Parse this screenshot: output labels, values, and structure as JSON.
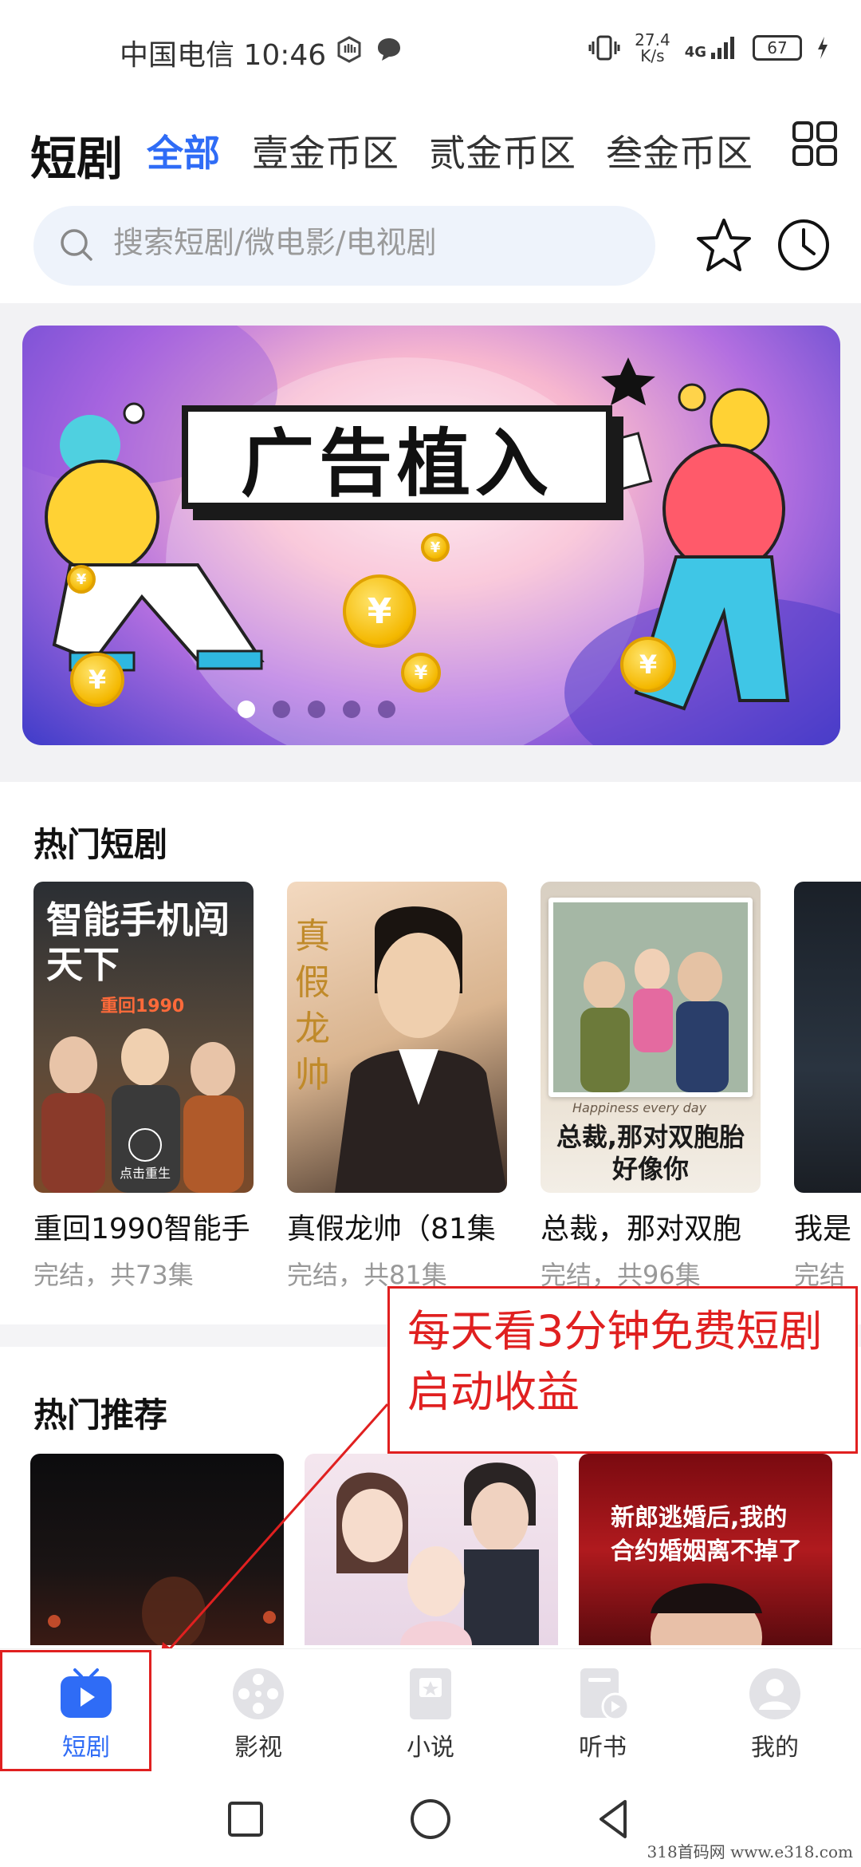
{
  "status_bar": {
    "carrier_time": "中国电信 10:46",
    "net_speed_value": "27.4",
    "net_speed_unit": "K/s",
    "network": "4G",
    "battery": "67"
  },
  "header": {
    "title": "短剧",
    "tabs": [
      {
        "label": "全部",
        "active": true
      },
      {
        "label": "壹金币区",
        "active": false
      },
      {
        "label": "贰金币区",
        "active": false
      },
      {
        "label": "叁金币区",
        "active": false
      }
    ],
    "grid_icon": "grid-icon"
  },
  "search": {
    "placeholder": "搜索短剧/微电影/电视剧",
    "favorite_icon": "star-icon",
    "history_icon": "clock-icon"
  },
  "banner": {
    "title": "广告植入",
    "dots": 5,
    "active_dot": 0
  },
  "hot_dramas": {
    "title": "热门短剧",
    "items": [
      {
        "name": "重回1990智能手",
        "meta": "完结，共73集",
        "poster_text": "智能手机闯天下",
        "poster_sub": "重回1990",
        "poster_button": "点击重生"
      },
      {
        "name": "真假龙帅（81集",
        "meta": "完结，共81集",
        "poster_text": "真假龙帅"
      },
      {
        "name": "总裁，那对双胞",
        "meta": "完结，共96集",
        "poster_text": "总裁,那对双胞胎好像你",
        "poster_sub": "Happiness every day"
      },
      {
        "name": "我是",
        "meta": "完结"
      }
    ]
  },
  "recommend": {
    "title": "热门推荐",
    "items": [
      {
        "poster_text": ""
      },
      {
        "poster_text": ""
      },
      {
        "poster_text": "新郎逃婚后,我的合约婚姻离不掉了"
      }
    ]
  },
  "annotation": {
    "text": "每天看3分钟免费短剧启动收益"
  },
  "bottom_nav": [
    {
      "label": "短剧",
      "icon": "play-tv-icon",
      "active": true
    },
    {
      "label": "影视",
      "icon": "film-reel-icon",
      "active": false
    },
    {
      "label": "小说",
      "icon": "book-icon",
      "active": false
    },
    {
      "label": "听书",
      "icon": "audiobook-icon",
      "active": false
    },
    {
      "label": "我的",
      "icon": "user-icon",
      "active": false
    }
  ],
  "watermark": "318首码网 www.e318.com",
  "colors": {
    "accent": "#2f6cf6",
    "annotation": "#e02020"
  }
}
